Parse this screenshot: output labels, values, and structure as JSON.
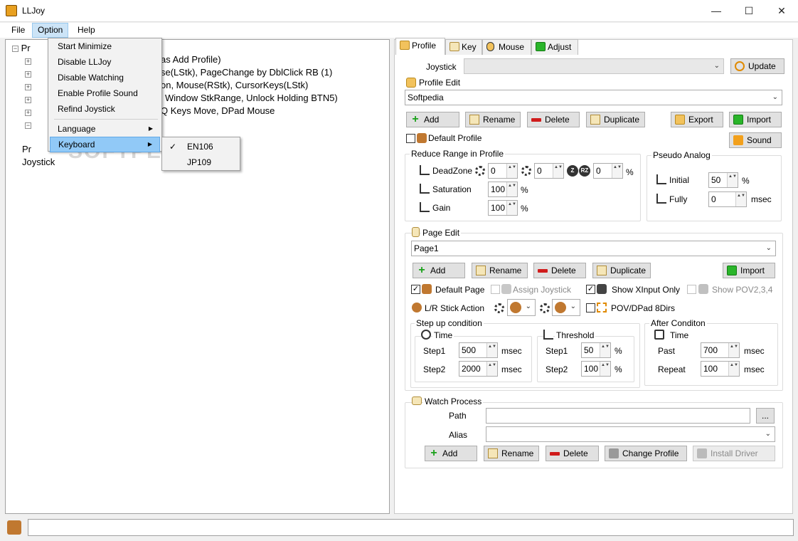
{
  "window": {
    "title": "LLJoy",
    "minimize": "—",
    "maximize": "☐",
    "close": "✕"
  },
  "menubar": {
    "file": "File",
    "option": "Option",
    "help": "Help"
  },
  "option_menu": {
    "items": [
      "Start Minimize",
      "Disable LLJoy",
      "Disable Watching",
      "Enable Profile Sound",
      "Refind Joystick"
    ],
    "language": "Language",
    "keyboard": "Keyboard",
    "submenu_arrow": "▶",
    "keyboard_sub": {
      "check": "✓",
      "items": [
        "EN106",
        "JP109"
      ]
    }
  },
  "tree": {
    "root1": "Pr",
    "root2": "Pr",
    "joystick": "Joystick",
    "rows": [
      "as Add Profile)",
      "se(LStk), PageChange by DblClick RB (1)",
      "on, Mouse(RStk), CursorKeys(LStk)",
      "Window StkRange, Unlock Holding BTN5)",
      "Q Keys Move, DPad Mouse"
    ]
  },
  "tabs": [
    "Profile",
    "Key",
    "Mouse",
    "Adjust"
  ],
  "profile": {
    "joystick_label": "Joystick",
    "joystick_value": "",
    "update_button": "Update",
    "profile_edit_title": "Profile Edit",
    "profile_value": "Softpedia",
    "buttons": {
      "add": "Add",
      "rename": "Rename",
      "delete": "Delete",
      "duplicate": "Duplicate",
      "export": "Export",
      "import": "Import",
      "sound": "Sound"
    },
    "default_profile": "Default Profile",
    "reduce_range": {
      "title": "Reduce Range in Profile",
      "deadzone": "DeadZone",
      "deadzone_l": "0",
      "deadzone_r": "0",
      "deadzone_z": "0",
      "z_icon": "Z",
      "rz_icon": "RZ",
      "saturation": "Saturation",
      "saturation_val": "100",
      "gain": "Gain",
      "gain_val": "100",
      "percent": "%"
    },
    "pseudo_analog": {
      "title": "Pseudo Analog",
      "initial": "Initial",
      "initial_val": "50",
      "initial_unit": "%",
      "fully": "Fully",
      "fully_val": "0",
      "fully_unit": "msec"
    }
  },
  "page_edit": {
    "title": "Page Edit",
    "page_value": "Page1",
    "add": "Add",
    "rename": "Rename",
    "delete": "Delete",
    "duplicate": "Duplicate",
    "import": "Import",
    "default_page": "Default Page",
    "assign_joystick": "Assign Joystick",
    "show_xinput": "Show XInput Only",
    "show_pov": "Show POV2,3,4",
    "lr_stick_action": "L/R Stick Action",
    "pov_dpad": "POV/DPad 8Dirs",
    "check_mark": "✓",
    "step_up": {
      "title": "Step up condition",
      "time": "Time",
      "step1": "Step1",
      "step1_val": "500",
      "step2": "Step2",
      "step2_val": "2000",
      "msec": "msec",
      "threshold": "Threshold",
      "t_step1": "Step1",
      "t_step1_val": "50",
      "t_step2": "Step2",
      "t_step2_val": "100",
      "percent": "%"
    },
    "after": {
      "title": "After Conditon",
      "time": "Time",
      "past": "Past",
      "past_val": "700",
      "repeat": "Repeat",
      "repeat_val": "100",
      "msec": "msec"
    }
  },
  "watch": {
    "title": "Watch Process",
    "path": "Path",
    "path_value": "",
    "browse": "...",
    "alias": "Alias",
    "alias_value": "",
    "add": "Add",
    "rename": "Rename",
    "delete": "Delete",
    "change_profile": "Change Profile",
    "install_driver": "Install Driver"
  },
  "statusbar": {
    "text": ""
  },
  "watermark": "SOFTPEDIA",
  "combo_arrow": "⌄",
  "spin_arrows": "▲▼",
  "colors": {
    "highlight": "#91c9f7",
    "menu_active": "#cce4f7",
    "green": "#1aa11a",
    "red": "#d01c1c"
  }
}
